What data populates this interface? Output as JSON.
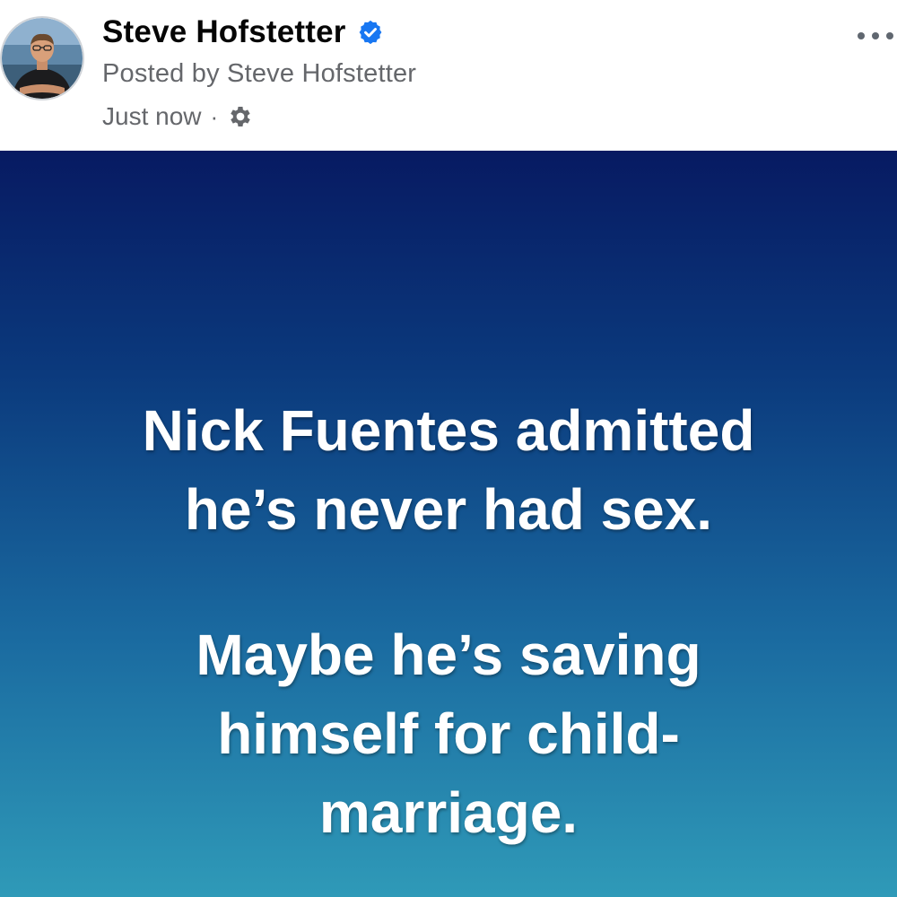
{
  "post": {
    "author": {
      "name": "Steve Hofstetter",
      "verified": true,
      "avatar_icon": "profile-photo"
    },
    "posted_by": "Posted by Steve Hofstetter",
    "timestamp": "Just now",
    "separator": "·",
    "privacy_icon": "gear-icon",
    "more_icon": "more-options-icon",
    "body": {
      "paragraph_1": {
        "line_1": "Nick Fuentes admitted",
        "line_2": "he’s never had sex."
      },
      "paragraph_2": {
        "line_1": "Maybe he’s saving",
        "line_2": "himself for child-",
        "line_3": "marriage."
      },
      "gradient": {
        "top": "#071a62",
        "bottom": "#2f9ab8"
      }
    },
    "colors": {
      "name": "#050505",
      "secondary": "#65676b",
      "verified": "#1877f2"
    }
  }
}
